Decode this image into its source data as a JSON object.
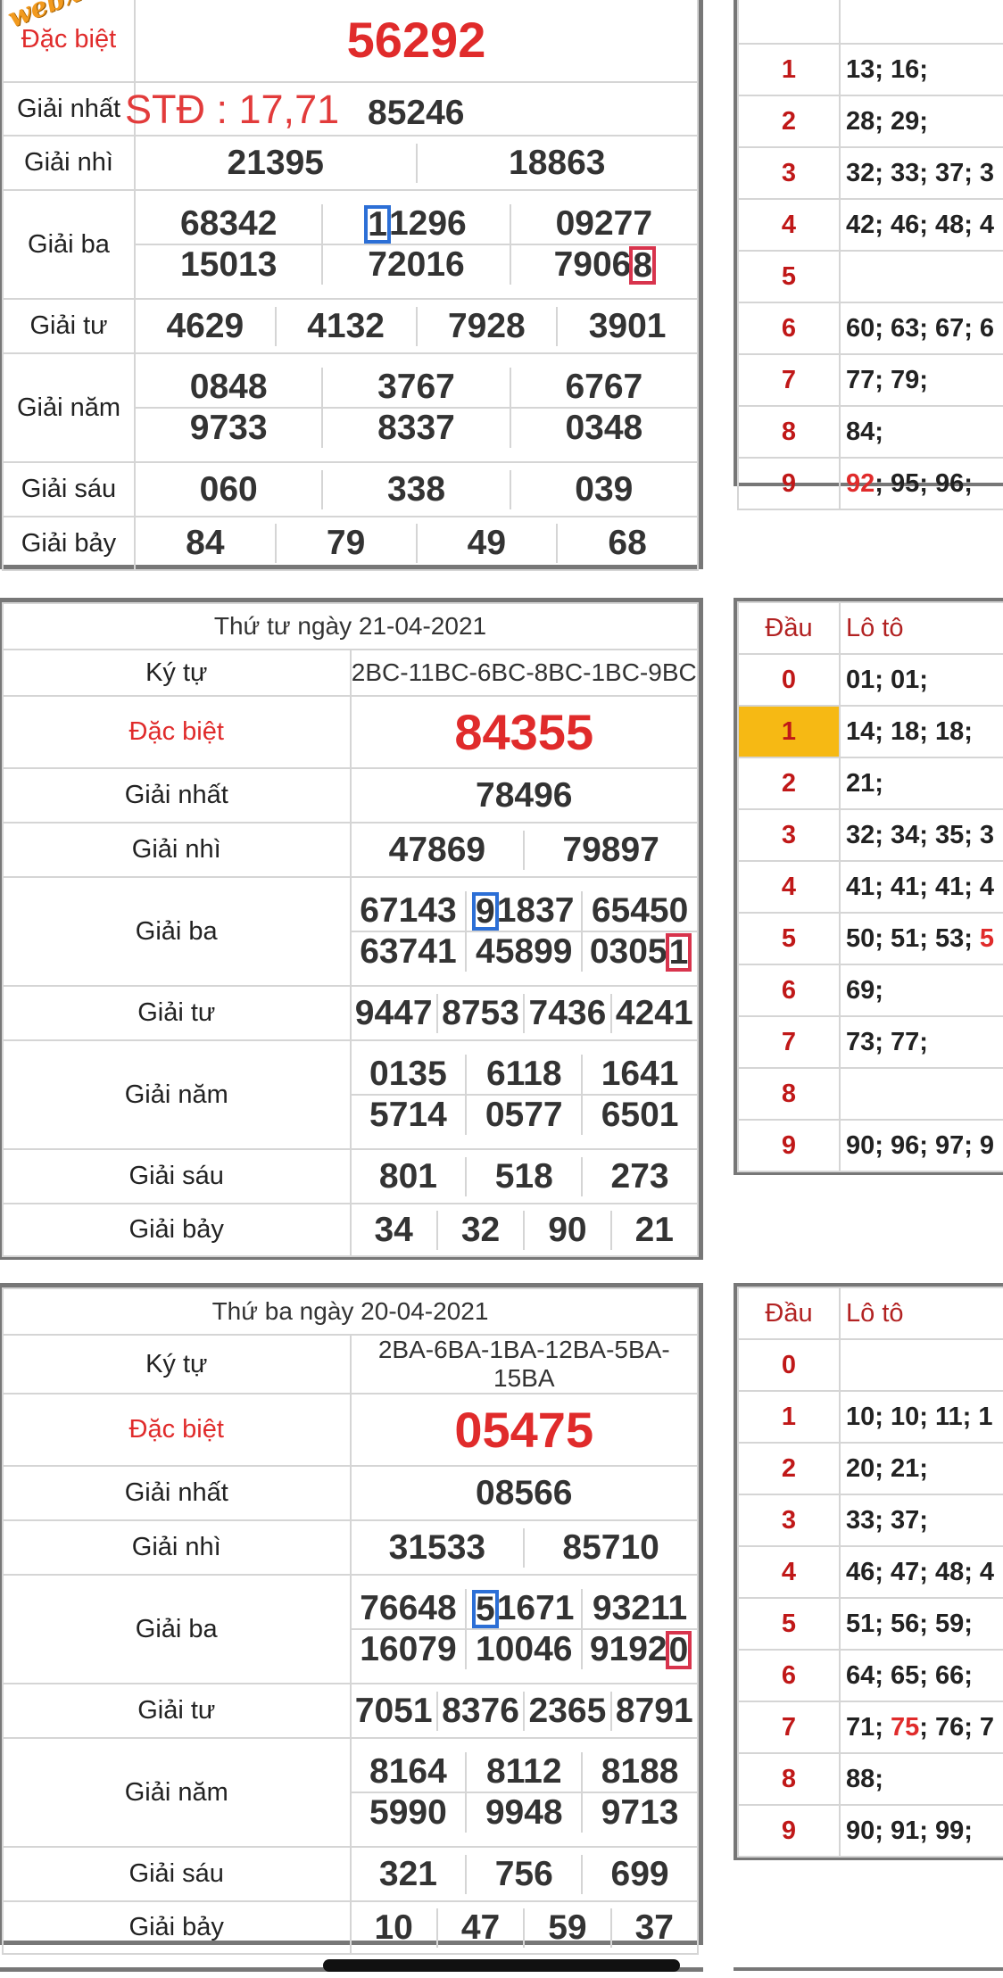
{
  "watermark": "webxoso.net",
  "block1": {
    "dac_biet_label": "Đặc biệt",
    "dac_biet_value": "56292",
    "giai_nhat_label": "Giải nhất",
    "std_text": "STĐ : 17,71",
    "giai_nhat_value": "85246",
    "giai_nhi_label": "Giải nhì",
    "giai_nhi": [
      "21395",
      "18863"
    ],
    "giai_ba_label": "Giải ba",
    "giai_ba_row1": [
      "68342",
      "1",
      "1296",
      "09277"
    ],
    "giai_ba_row2": [
      "15013",
      "72016",
      "7906",
      "8"
    ],
    "giai_tu_label": "Giải tư",
    "giai_tu": [
      "4629",
      "4132",
      "7928",
      "3901"
    ],
    "giai_nam_label": "Giải năm",
    "giai_nam_row1": [
      "0848",
      "3767",
      "6767"
    ],
    "giai_nam_row2": [
      "9733",
      "8337",
      "0348"
    ],
    "giai_sau_label": "Giải sáu",
    "giai_sau": [
      "060",
      "338",
      "039"
    ],
    "giai_bay_label": "Giải bảy",
    "giai_bay": [
      "84",
      "79",
      "49",
      "68"
    ]
  },
  "loto1": {
    "rows": [
      {
        "dau": "1",
        "lo": "13; 16;"
      },
      {
        "dau": "2",
        "lo": "28; 29;"
      },
      {
        "dau": "3",
        "lo": "32; 33; 37; 3"
      },
      {
        "dau": "4",
        "lo": "42; 46; 48; 4"
      },
      {
        "dau": "5",
        "lo": ""
      },
      {
        "dau": "6",
        "lo": "60; 63; 67; 6"
      },
      {
        "dau": "7",
        "lo": "77; 79;"
      },
      {
        "dau": "8",
        "lo": "84;"
      }
    ],
    "last": {
      "dau": "9",
      "red": "92",
      "rest": "; 95; 96;"
    }
  },
  "block2": {
    "date": "Thứ tư ngày 21-04-2021",
    "ky_tu_label": "Ký tự",
    "ky_tu": "2BC-11BC-6BC-8BC-1BC-9BC",
    "dac_biet_label": "Đặc biệt",
    "dac_biet_value": "84355",
    "giai_nhat_label": "Giải nhất",
    "giai_nhat_value": "78496",
    "giai_nhi_label": "Giải nhì",
    "giai_nhi": [
      "47869",
      "79897"
    ],
    "giai_ba_label": "Giải ba",
    "giai_ba_row1": [
      "67143",
      "9",
      "1837",
      "65450"
    ],
    "giai_ba_row2": [
      "63741",
      "45899",
      "0305",
      "1"
    ],
    "giai_tu_label": "Giải tư",
    "giai_tu": [
      "9447",
      "8753",
      "7436",
      "4241"
    ],
    "giai_nam_label": "Giải năm",
    "giai_nam_row1": [
      "0135",
      "6118",
      "1641"
    ],
    "giai_nam_row2": [
      "5714",
      "0577",
      "6501"
    ],
    "giai_sau_label": "Giải sáu",
    "giai_sau": [
      "801",
      "518",
      "273"
    ],
    "giai_bay_label": "Giải bảy",
    "giai_bay": [
      "34",
      "32",
      "90",
      "21"
    ]
  },
  "loto2": {
    "header": {
      "dau": "Đầu",
      "lo": "Lô tô"
    },
    "rows": [
      {
        "dau": "0",
        "lo": "01; 01;"
      },
      {
        "dau": "1",
        "lo": "14; 18; 18;"
      },
      {
        "dau": "2",
        "lo": "21;"
      },
      {
        "dau": "3",
        "lo": "32; 34; 35; 3"
      },
      {
        "dau": "4",
        "lo": "41; 41; 41; 4"
      },
      {
        "dau": "5",
        "lo": "50; 51; 53; "
      },
      {
        "dau": "6",
        "lo": "69;"
      },
      {
        "dau": "7",
        "lo": "73; 77;"
      },
      {
        "dau": "8",
        "lo": ""
      },
      {
        "dau": "9",
        "lo": "90; 96; 97; 9"
      }
    ],
    "row5_red_tail": "5",
    "highlight_color": "#f6b914"
  },
  "block3": {
    "date": "Thứ ba ngày 20-04-2021",
    "ky_tu_label": "Ký tự",
    "ky_tu": "2BA-6BA-1BA-12BA-5BA-15BA",
    "dac_biet_label": "Đặc biệt",
    "dac_biet_value": "05475",
    "giai_nhat_label": "Giải nhất",
    "giai_nhat_value": "08566",
    "giai_nhi_label": "Giải nhì",
    "giai_nhi": [
      "31533",
      "85710"
    ],
    "giai_ba_label": "Giải ba",
    "giai_ba_row1": [
      "76648",
      "5",
      "1671",
      "93211"
    ],
    "giai_ba_row2": [
      "16079",
      "10046",
      "9192",
      "0"
    ],
    "giai_tu_label": "Giải tư",
    "giai_tu": [
      "7051",
      "8376",
      "2365",
      "8791"
    ],
    "giai_nam_label": "Giải năm",
    "giai_nam_row1": [
      "8164",
      "8112",
      "8188"
    ],
    "giai_nam_row2": [
      "5990",
      "9948",
      "9713"
    ],
    "giai_sau_label": "Giải sáu",
    "giai_sau": [
      "321",
      "756",
      "699"
    ],
    "giai_bay_label": "Giải bảy",
    "giai_bay": [
      "10",
      "47",
      "59",
      "37"
    ]
  },
  "loto3": {
    "header": {
      "dau": "Đầu",
      "lo": "Lô tô"
    },
    "rows": [
      {
        "dau": "0",
        "lo": ""
      },
      {
        "dau": "1",
        "lo": "10; 10; 11; 1"
      },
      {
        "dau": "2",
        "lo": "20; 21;"
      },
      {
        "dau": "3",
        "lo": "33; 37;"
      },
      {
        "dau": "4",
        "lo": "46; 47; 48; 4"
      },
      {
        "dau": "5",
        "lo": "51; 56; 59;"
      },
      {
        "dau": "6",
        "lo": "64; 65; 66;"
      },
      {
        "dau": "8",
        "lo": "88;"
      },
      {
        "dau": "9",
        "lo": "90; 91; 99;"
      }
    ],
    "row7": {
      "dau": "7",
      "pre": "71; ",
      "red": "75",
      "post": "; 76; 7"
    }
  },
  "colors": {
    "red": "#e02b2b",
    "blue_box": "#2c6fd6",
    "red_box": "#d8344d",
    "border": "#777777"
  }
}
